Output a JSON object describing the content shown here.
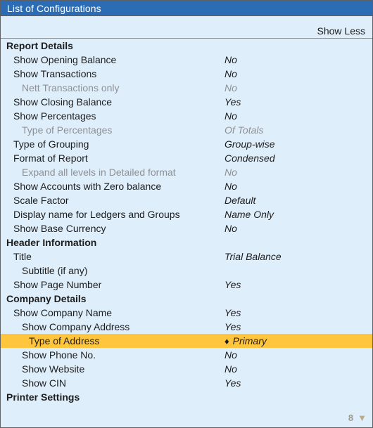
{
  "window": {
    "title": "List of Configurations"
  },
  "header": {
    "show_less_label": "Show Less"
  },
  "footer": {
    "page_number": "8",
    "caret_icon": "▼"
  },
  "colors": {
    "titlebar": "#2b6cb5",
    "background": "#dfeefb",
    "highlight": "#ffc53d",
    "text": "#1d1d1d",
    "disabled_text": "#8d9094"
  },
  "rows": [
    {
      "label": "Report Details",
      "value": "",
      "type": "section",
      "indent": 0,
      "disabled": false,
      "selected": false
    },
    {
      "label": "Show Opening Balance",
      "value": "No",
      "type": "item",
      "indent": 1,
      "disabled": false,
      "selected": false
    },
    {
      "label": "Show Transactions",
      "value": "No",
      "type": "item",
      "indent": 1,
      "disabled": false,
      "selected": false
    },
    {
      "label": "Nett Transactions only",
      "value": "No",
      "type": "item",
      "indent": 2,
      "disabled": true,
      "selected": false
    },
    {
      "label": "Show Closing Balance",
      "value": "Yes",
      "type": "item",
      "indent": 1,
      "disabled": false,
      "selected": false
    },
    {
      "label": "Show Percentages",
      "value": "No",
      "type": "item",
      "indent": 1,
      "disabled": false,
      "selected": false
    },
    {
      "label": "Type of Percentages",
      "value": "Of Totals",
      "type": "item",
      "indent": 2,
      "disabled": true,
      "selected": false
    },
    {
      "label": "Type of Grouping",
      "value": "Group-wise",
      "type": "item",
      "indent": 1,
      "disabled": false,
      "selected": false
    },
    {
      "label": "Format of Report",
      "value": "Condensed",
      "type": "item",
      "indent": 1,
      "disabled": false,
      "selected": false
    },
    {
      "label": "Expand all levels in Detailed format",
      "value": "No",
      "type": "item",
      "indent": 2,
      "disabled": true,
      "selected": false
    },
    {
      "label": "Show Accounts with Zero balance",
      "value": "No",
      "type": "item",
      "indent": 1,
      "disabled": false,
      "selected": false
    },
    {
      "label": "Scale Factor",
      "value": "Default",
      "type": "item",
      "indent": 1,
      "disabled": false,
      "selected": false
    },
    {
      "label": "Display name for Ledgers and Groups",
      "value": "Name Only",
      "type": "item",
      "indent": 1,
      "disabled": false,
      "selected": false
    },
    {
      "label": "Show Base Currency",
      "value": "No",
      "type": "item",
      "indent": 1,
      "disabled": false,
      "selected": false
    },
    {
      "label": "Header Information",
      "value": "",
      "type": "section",
      "indent": 0,
      "disabled": false,
      "selected": false
    },
    {
      "label": "Title",
      "value": "Trial Balance",
      "type": "item",
      "indent": 1,
      "disabled": false,
      "selected": false
    },
    {
      "label": "Subtitle (if any)",
      "value": "",
      "type": "item",
      "indent": 2,
      "disabled": false,
      "selected": false
    },
    {
      "label": "Show Page Number",
      "value": "Yes",
      "type": "item",
      "indent": 1,
      "disabled": false,
      "selected": false
    },
    {
      "label": "Company Details",
      "value": "",
      "type": "section",
      "indent": 0,
      "disabled": false,
      "selected": false
    },
    {
      "label": "Show Company Name",
      "value": "Yes",
      "type": "item",
      "indent": 1,
      "disabled": false,
      "selected": false
    },
    {
      "label": "Show Company Address",
      "value": "Yes",
      "type": "item",
      "indent": 2,
      "disabled": false,
      "selected": false
    },
    {
      "label": "Type of Address",
      "value": "Primary",
      "type": "item",
      "indent": 3,
      "disabled": false,
      "selected": true,
      "marker": "♦"
    },
    {
      "label": "Show Phone No.",
      "value": "No",
      "type": "item",
      "indent": 2,
      "disabled": false,
      "selected": false
    },
    {
      "label": "Show Website",
      "value": "No",
      "type": "item",
      "indent": 2,
      "disabled": false,
      "selected": false
    },
    {
      "label": "Show CIN",
      "value": "Yes",
      "type": "item",
      "indent": 2,
      "disabled": false,
      "selected": false
    },
    {
      "label": "Printer Settings",
      "value": "",
      "type": "section",
      "indent": 0,
      "disabled": false,
      "selected": false
    }
  ]
}
